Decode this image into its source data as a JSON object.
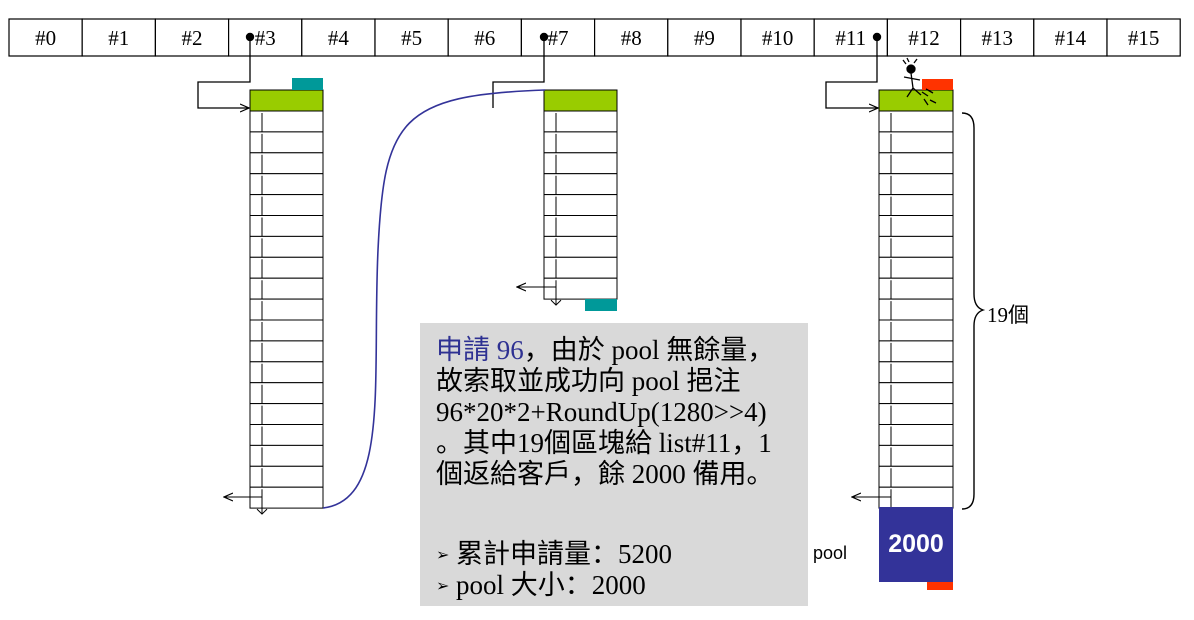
{
  "slots": [
    "#0",
    "#1",
    "#2",
    "#3",
    "#4",
    "#5",
    "#6",
    "#7",
    "#8",
    "#9",
    "#10",
    "#11",
    "#12",
    "#13",
    "#14",
    "#15"
  ],
  "colors": {
    "green": "#99cc00",
    "teal": "#009999",
    "red": "#ff3300",
    "navy": "#333399",
    "curve": "#333399",
    "panel": "#d9d9d9",
    "highlight": "#2e3192"
  },
  "info": {
    "highlight": "申請 96",
    "line1_rest": "，由於 pool 無餘量，",
    "line2": "故索取並成功向 pool 挹注",
    "line3": "96*20*2+RoundUp(1280>>4)",
    "line4": "。其中19個區塊給 list#11，1",
    "line5": "個返給客戶，餘 2000 備用。",
    "bullet1": "累計申請量：5200",
    "bullet2": "pool 大小：2000"
  },
  "pool_label": "pool",
  "pool_value": "2000",
  "brace_label": "19個",
  "icons": [
    "bullet-arrow-icon",
    "person-icon",
    "pointer-dot-icon",
    "arrow-head-icon"
  ]
}
